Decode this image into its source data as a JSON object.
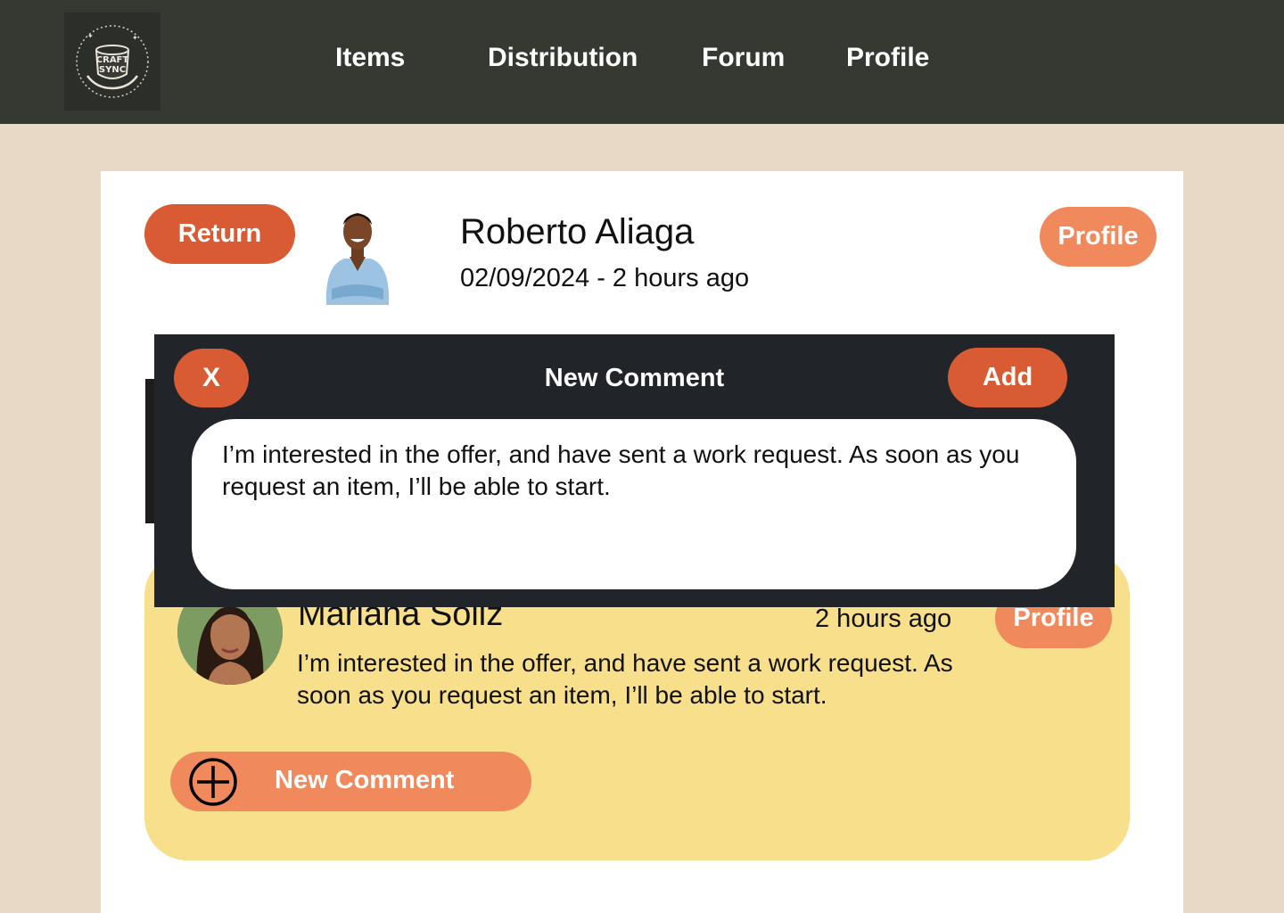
{
  "header": {
    "logo_text_line1": "CRAFT",
    "logo_text_line2": "SYNC",
    "nav": [
      "Items",
      "Distribution",
      "Forum",
      "Profile"
    ]
  },
  "post": {
    "return_label": "Return",
    "author_name": "Roberto Aliaga",
    "date_text": "02/09/2024 - 2 hours ago",
    "profile_label": "Profile"
  },
  "comment": {
    "author_name": "Mariana Soliz",
    "time": "2 hours ago",
    "text": "I’m interested in the offer, and have sent a work request. As soon as you request an item, I’ll be able to start.",
    "profile_label": "Profile"
  },
  "new_comment_label": "New Comment",
  "modal": {
    "close_label": "X",
    "title": "New Comment",
    "add_label": "Add",
    "input_value": "I’m interested in the offer, and have sent a work request. As soon as you request an item, I’ll be able to start."
  },
  "colors": {
    "topbar": "#363832",
    "page_bg": "#e8d9c7",
    "accent_dark": "#d95b33",
    "accent_light": "#f08a5d",
    "comment_bg": "#f8df8b",
    "modal_bg": "#212429"
  }
}
